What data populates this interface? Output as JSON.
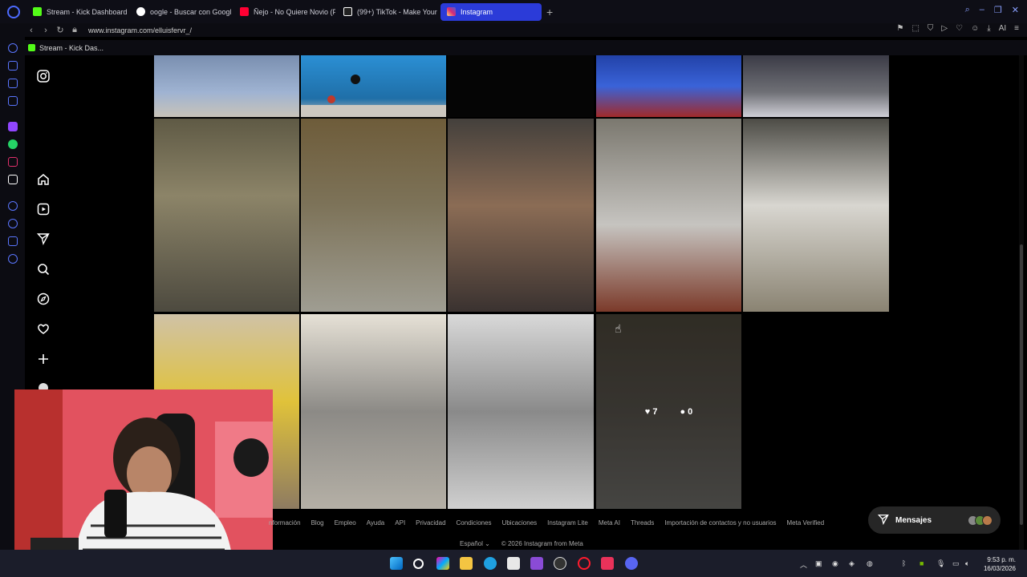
{
  "browser": {
    "tabs": [
      {
        "label": "Stream - Kick Dashboard",
        "icon": "kick-icon",
        "color": "#53fc18"
      },
      {
        "label": "oogle - Buscar con Googl",
        "icon": "google-icon",
        "color": "#4285f4"
      },
      {
        "label": "Ñejo - No Quiere Novio (F",
        "icon": "youtube-icon",
        "color": "#ff0033"
      },
      {
        "label": "(99+) TikTok - Make Your",
        "icon": "tiktok-icon",
        "color": "#ffffff"
      },
      {
        "label": "Instagram",
        "icon": "instagram-icon",
        "color": "#e1306c",
        "active": true
      }
    ],
    "new_tab": "+",
    "url": "www.instagram.com/elluisfervr_/",
    "bookmark": "Stream - Kick Das..."
  },
  "photos": [
    {
      "bg": "linear-gradient(180deg,#7a8fb0,#9fb3d2 60%,#c8c3b8)",
      "desc": "cropped"
    },
    {
      "bg": "linear-gradient(180deg,#2b8fd4,#1f6fa8 70%,#c2bfb9)",
      "desc": "cropped"
    },
    {
      "bg": "#050505",
      "desc": "cropped"
    },
    {
      "bg": "linear-gradient(180deg,#2242a8,#3a63d8 50%,#a12a2a)",
      "desc": "cropped"
    },
    {
      "bg": "linear-gradient(180deg,#3b3b46,#6f7076 60%,#cfcfd6)",
      "desc": "cropped"
    },
    {
      "bg": "linear-gradient(180deg,#5f5a45,#8c8468 40%,#4d4a3f)",
      "desc": "portrait"
    },
    {
      "bg": "linear-gradient(180deg,#6e5c3a,#7d7359 45%,#9f9d92)",
      "desc": "portrait"
    },
    {
      "bg": "linear-gradient(180deg,#44403c,#8b6c55 45%,#3a3230)",
      "desc": "portrait"
    },
    {
      "bg": "linear-gradient(180deg,#7b786f,#c6c4c0 55%,#7b3a2a)",
      "desc": "portrait"
    },
    {
      "bg": "linear-gradient(180deg,#4d4c46,#d8d6d0 45%,#8a8372)",
      "desc": "portrait"
    },
    {
      "bg": "linear-gradient(180deg,#d0c2a6,#e0c23a 45%,#8e7b61)",
      "desc": "portrait"
    },
    {
      "bg": "linear-gradient(180deg,#e6e1d6,#8c8a86 50%,#b5b0a6)",
      "desc": "portrait"
    },
    {
      "bg": "linear-gradient(180deg,#d9d9d9,#8a8a8a 50%,#cfcfcf)",
      "desc": "portrait"
    },
    {
      "bg": "linear-gradient(180deg,#4a4438,#55514a 50%,#6b6a66)",
      "desc": "portrait",
      "likes": "7",
      "comments": "0"
    }
  ],
  "footer": {
    "links": [
      "nformación",
      "Blog",
      "Empleo",
      "Ayuda",
      "API",
      "Privacidad",
      "Condiciones",
      "Ubicaciones",
      "Instagram Lite",
      "Meta AI",
      "Threads",
      "Importación de contactos y no usuarios",
      "Meta Verified"
    ],
    "language": "Español",
    "copyright": "© 2026 Instagram from Meta"
  },
  "messages": {
    "label": "Mensajes"
  },
  "taskbar": {
    "time": "9:53 p. m.",
    "date": "16/03/2026"
  }
}
